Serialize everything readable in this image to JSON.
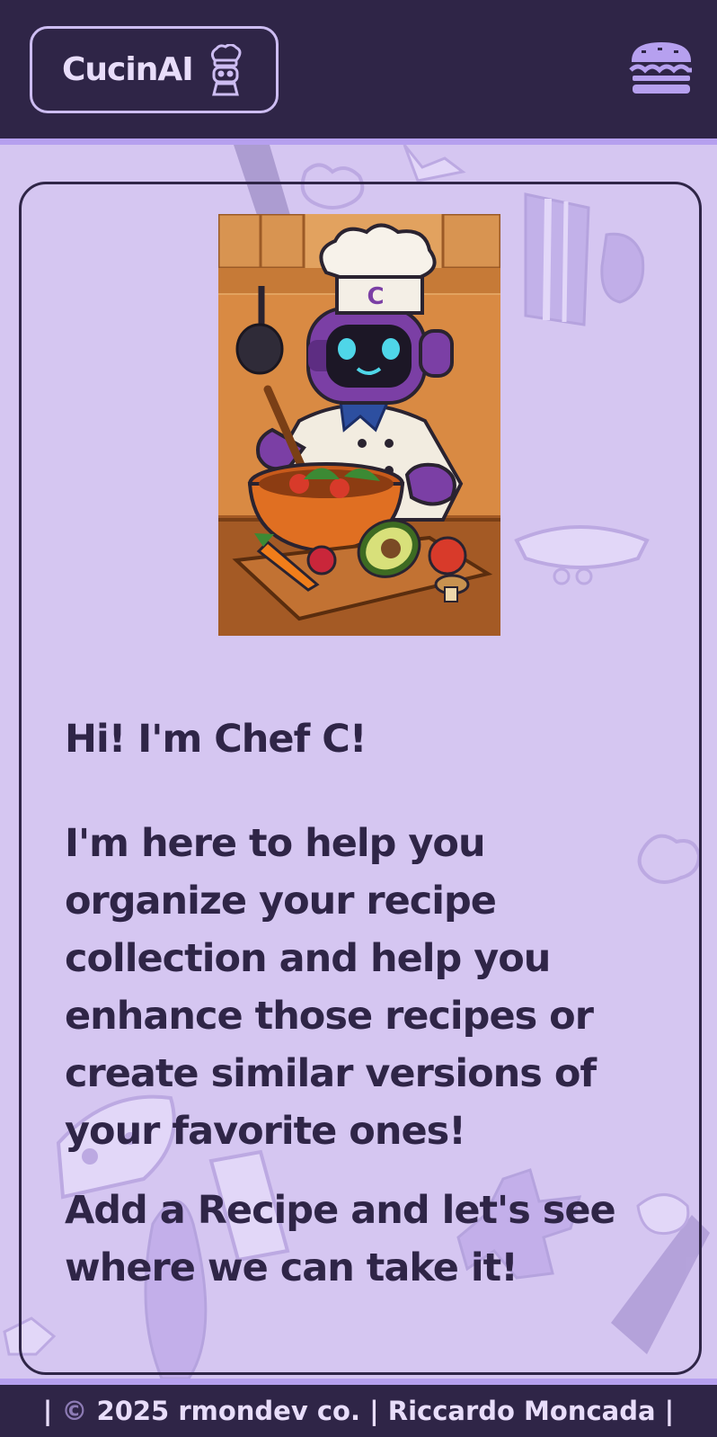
{
  "header": {
    "brand_label": "CucinAI",
    "brand_icon": "chef-robot-icon",
    "menu_icon": "burger-menu-icon"
  },
  "hero": {
    "image": "robot-chef-cooking-illustration",
    "hat_letter": "C"
  },
  "intro": {
    "greeting": "Hi! I'm Chef C!",
    "description": "I'm here to help you organize your recipe collection and help you enhance those recipes or create similar versions of your favorite ones!",
    "call_to_action": "Add a Recipe and let's see where we can take it!"
  },
  "footer": {
    "prefix": "| ",
    "copyright_symbol": "©",
    "text": " 2025 rmondev co. | Riccardo Moncada |"
  },
  "colors": {
    "header_bg": "#2f2547",
    "accent": "#b6a0ef",
    "page_bg": "#d5c6f1",
    "text": "#2f2547",
    "robot_purple": "#7b3fa5"
  }
}
